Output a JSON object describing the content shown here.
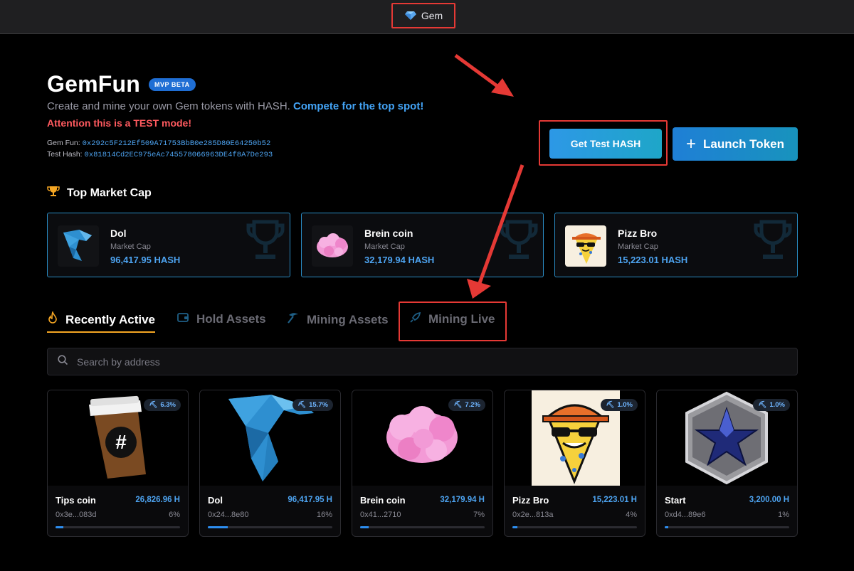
{
  "topbar": {
    "tab_label": "Gem",
    "tab_icon": "gem-icon"
  },
  "header": {
    "title": "GemFun",
    "badge": "MVP BETA",
    "tagline": "Create and mine your own Gem tokens with HASH.",
    "tagline_highlight": "Compete for the top spot!",
    "attention": "Attention this is a TEST mode!",
    "gemfun_label": "Gem Fun:",
    "gemfun_address": "0x292c5F212Ef509A71753BbB0e285D80E64250b52",
    "testhash_label": "Test Hash:",
    "testhash_address": "0x81814Cd2EC975eAc745578066963DE4f8A7De293",
    "get_hash_label": "Get Test HASH",
    "launch_label": "Launch Token",
    "launch_icon": "plus-icon"
  },
  "top_market_cap": {
    "title": "Top Market Cap",
    "icon": "trophy-icon",
    "market_cap_label": "Market Cap",
    "items": [
      {
        "name": "Dol",
        "value": "96,417.95 HASH",
        "image": "dolphin"
      },
      {
        "name": "Brein coin",
        "value": "32,179.94 HASH",
        "image": "brain"
      },
      {
        "name": "Pizz Bro",
        "value": "15,223.01 HASH",
        "image": "pizza"
      }
    ]
  },
  "tabs": [
    {
      "label": "Recently Active",
      "icon": "flame-icon",
      "active": true
    },
    {
      "label": "Hold Assets",
      "icon": "wallet-icon",
      "active": false
    },
    {
      "label": "Mining Assets",
      "icon": "pickaxe-icon",
      "active": false
    },
    {
      "label": "Mining Live",
      "icon": "rocket-icon",
      "active": false
    }
  ],
  "search": {
    "placeholder": "Search by address",
    "icon": "search-icon"
  },
  "tokens": [
    {
      "name": "Tips coin",
      "value": "26,826.96 H",
      "address": "0x3e...083d",
      "percent": "6%",
      "badge": "6.3%",
      "progress": 0.06,
      "image": "coffee"
    },
    {
      "name": "Dol",
      "value": "96,417.95 H",
      "address": "0x24...8e80",
      "percent": "16%",
      "badge": "15.7%",
      "progress": 0.16,
      "image": "dolphin"
    },
    {
      "name": "Brein coin",
      "value": "32,179.94 H",
      "address": "0x41...2710",
      "percent": "7%",
      "badge": "7.2%",
      "progress": 0.07,
      "image": "brain"
    },
    {
      "name": "Pizz Bro",
      "value": "15,223.01 H",
      "address": "0x2e...813a",
      "percent": "4%",
      "badge": "1.0%",
      "progress": 0.04,
      "image": "pizza"
    },
    {
      "name": "Start",
      "value": "3,200.00 H",
      "address": "0xd4...89e6",
      "percent": "1%",
      "badge": "1.0%",
      "progress": 0.01,
      "image": "star-medal"
    }
  ],
  "colors": {
    "accent": "#2d98e6",
    "highlight_red": "#e53935",
    "tab_active_underline": "#f5a623",
    "value_blue": "#4da3f0"
  }
}
